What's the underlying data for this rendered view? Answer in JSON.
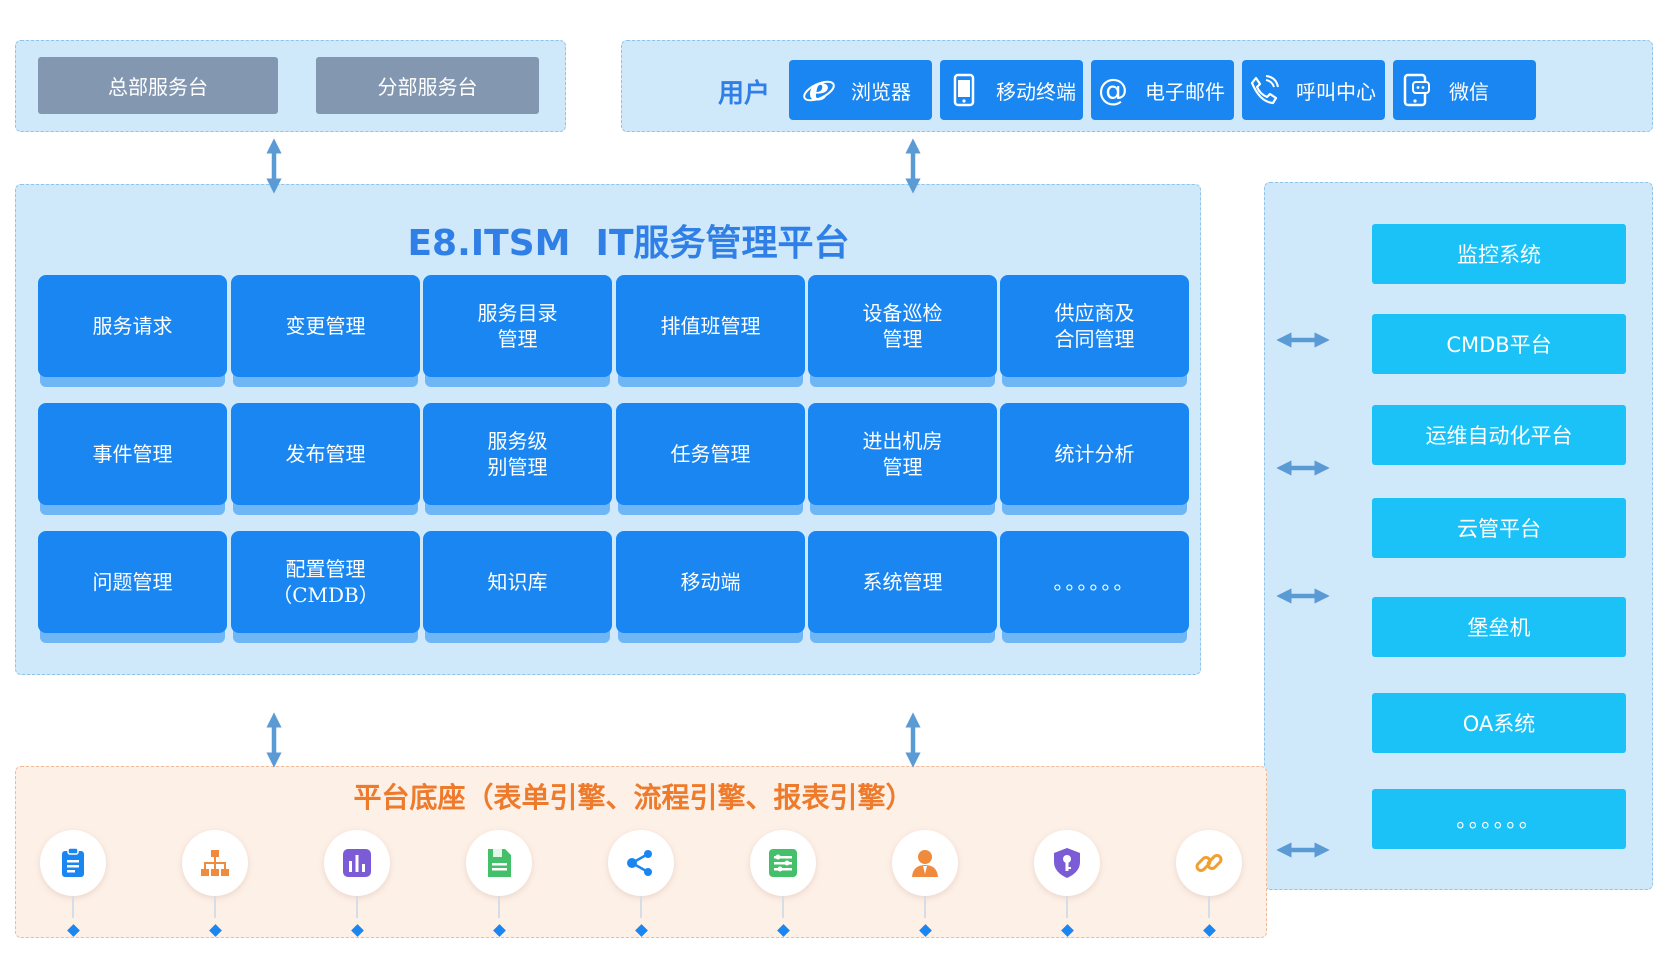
{
  "top_left": {
    "buttons": [
      "总部服务台",
      "分部服务台"
    ]
  },
  "users": {
    "label": "用户",
    "channels": [
      {
        "label": "浏览器",
        "icon": "ie-browser-icon"
      },
      {
        "label": "移动终端",
        "icon": "mobile-phone-icon"
      },
      {
        "label": "电子邮件",
        "icon": "at-email-icon"
      },
      {
        "label": "呼叫中心",
        "icon": "phone-call-icon"
      },
      {
        "label": "微信",
        "icon": "wechat-phone-icon"
      }
    ]
  },
  "platform": {
    "title": "E8.ITSM  IT服务管理平台",
    "modules": [
      [
        "服务请求",
        "变更管理",
        "服务目录\n管理",
        "排值班管理",
        "设备巡检\n管理",
        "供应商及\n合同管理"
      ],
      [
        "事件管理",
        "发布管理",
        "服务级\n别管理",
        "任务管理",
        "进出机房\n管理",
        "统计分析"
      ],
      [
        "问题管理",
        "配置管理\n（CMDB）",
        "知识库",
        "移动端",
        "系统管理",
        "。。。。。。"
      ]
    ]
  },
  "systems": [
    "监控系统",
    "CMDB平台",
    "运维自动化平台",
    "云管平台",
    "堡垒机",
    "OA系统",
    "。。。。。。"
  ],
  "base": {
    "title": "平台底座（表单引擎、流程引擎、报表引擎）",
    "icons": [
      "clipboard-icon",
      "org-chart-icon",
      "bar-chart-icon",
      "document-icon",
      "share-nodes-icon",
      "list-settings-icon",
      "user-icon",
      "shield-key-icon",
      "link-icon"
    ]
  },
  "colors": {
    "primary": "#1a86f2",
    "title": "#2f7fe6",
    "system": "#1ac2f7",
    "gray_button": "#8497b0",
    "panel": "#cfe9fa",
    "base_panel": "#fdf0e7",
    "base_title": "#ee7a2b",
    "arrow": "#5b9bd5"
  }
}
